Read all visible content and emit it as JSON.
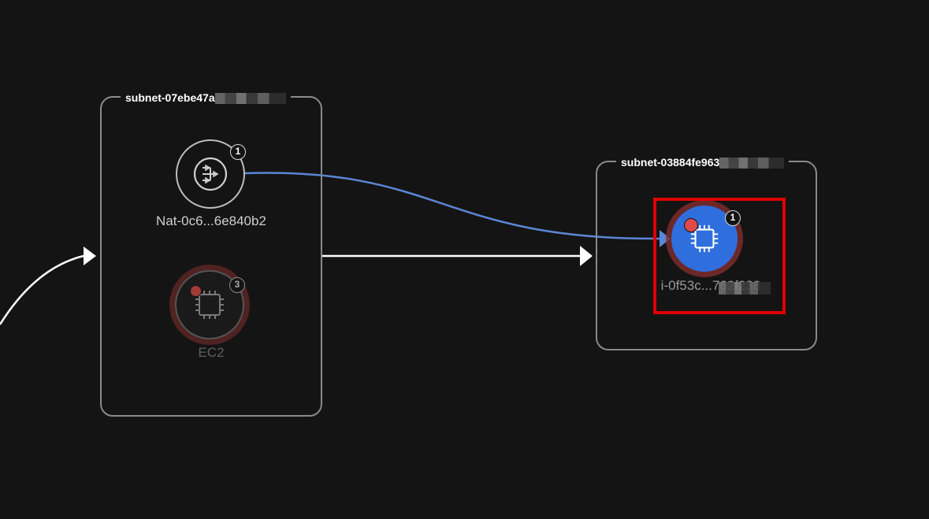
{
  "subnets": [
    {
      "label": "subnet-07ebe47a",
      "nodes": {
        "nat": {
          "label": "Nat-0c6...6e840b2",
          "count": "1",
          "icon": "nat-gateway-icon"
        },
        "ec2_group": {
          "label": "EC2",
          "count": "3",
          "icon": "cpu-chip-icon",
          "status": "alert"
        }
      }
    },
    {
      "label": "subnet-03884fe963",
      "nodes": {
        "ec2_instance": {
          "label": "i-0f53c...762f238",
          "count": "1",
          "icon": "cpu-chip-icon",
          "status": "alert"
        }
      }
    }
  ],
  "colors": {
    "background": "#141414",
    "edge_default": "#ffffff",
    "edge_highlight": "#5b86d6",
    "instance_fill": "#2f6fdd",
    "alert": "#e04a4a",
    "selection": "#e00000"
  }
}
